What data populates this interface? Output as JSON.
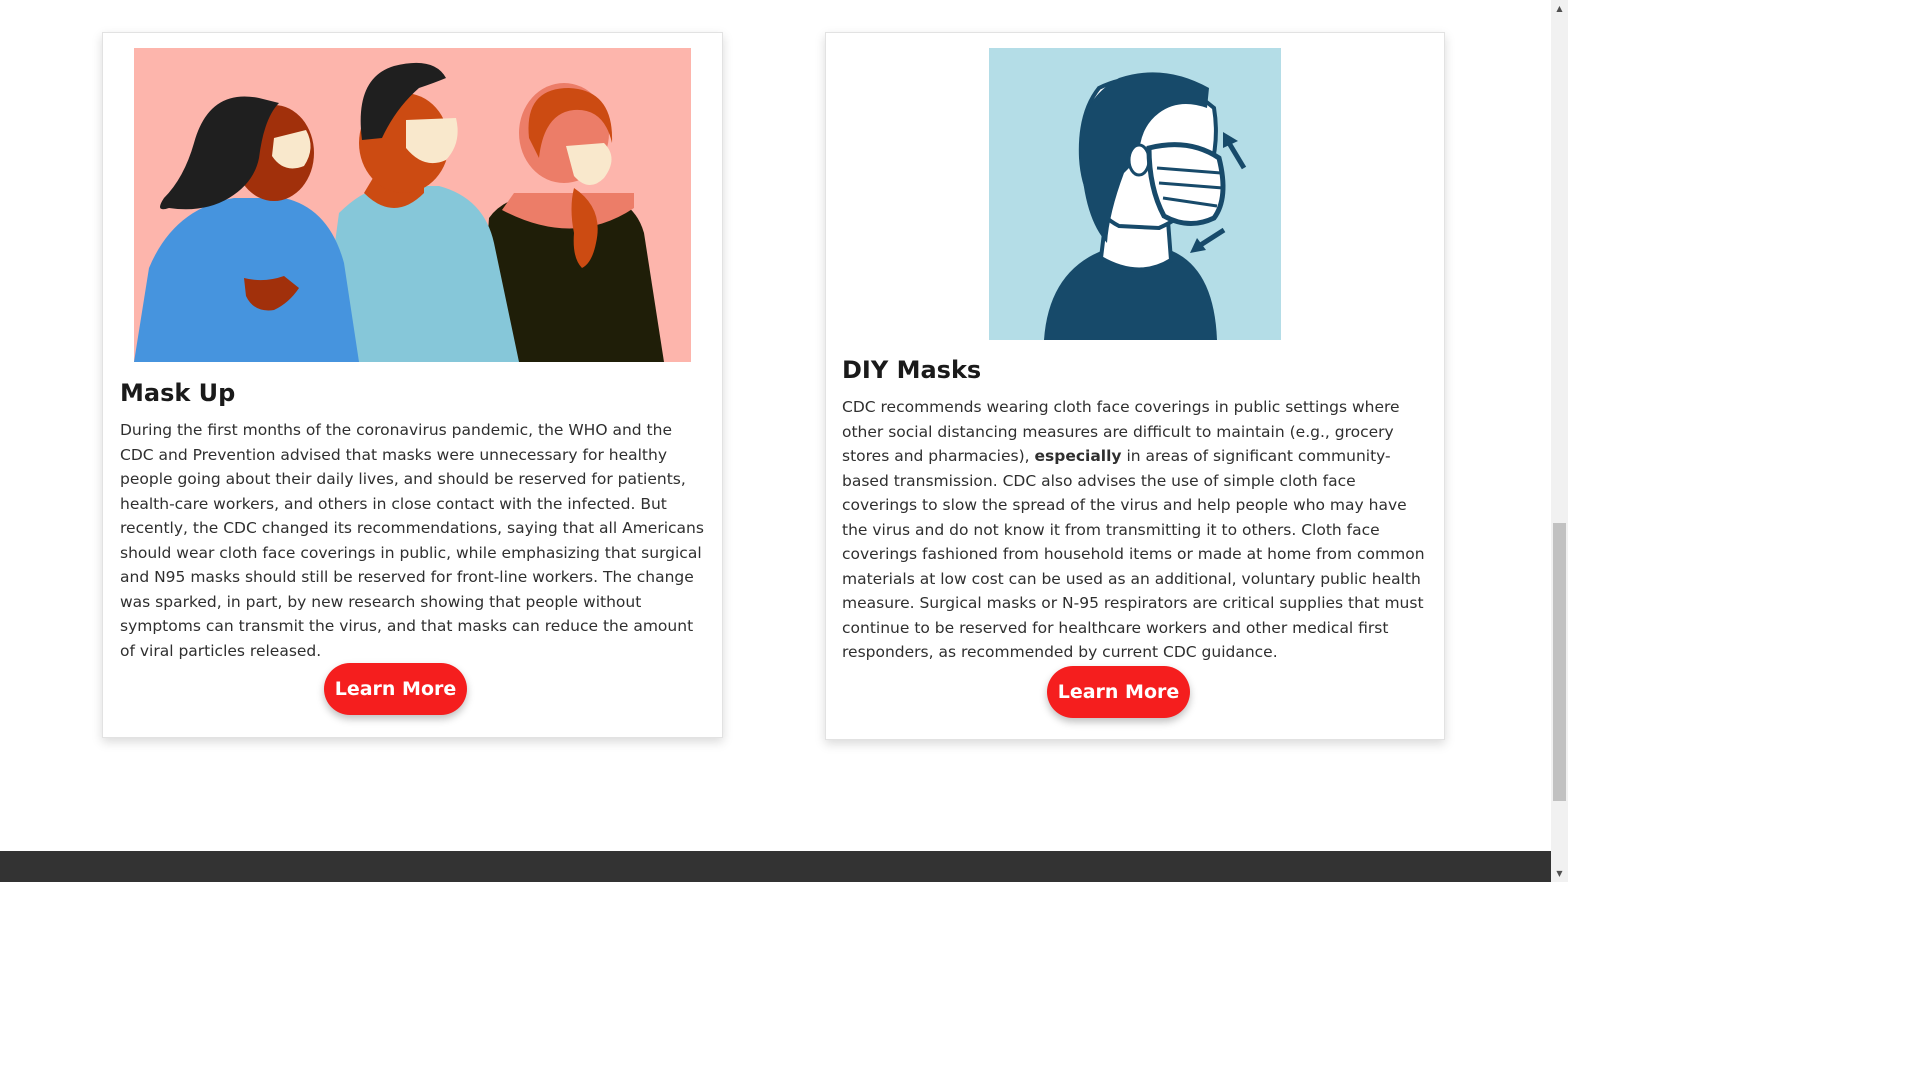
{
  "cards": [
    {
      "title": "Mask Up",
      "text": "During the first months of the coronavirus pandemic, the WHO and the CDC and Prevention advised that masks were unnecessary for healthy people going about their daily lives, and should be reserved for patients, health-care workers, and others in close contact with the infected. But recently, the CDC changed its recommendations, saying that all Americans should wear cloth face coverings in public, while emphasizing that surgical and N95 masks should still be reserved for front-line workers. The change was sparked, in part, by new research showing that people without symptoms can transmit the virus, and that masks can reduce the amount of viral particles released.",
      "button_label": "Learn More",
      "illustration": "three-people-wearing-masks",
      "illustration_bg": "#fdb5ac"
    },
    {
      "title": "DIY Masks",
      "text_part1": "CDC recommends wearing cloth face coverings in public settings where other social distancing measures are difficult to maintain (e.g., grocery stores and pharmacies), ",
      "text_emphasis": "especially",
      "text_part2": " in areas of significant community-based transmission. CDC also advises the use of simple cloth face coverings to slow the spread of the virus and help people who may have the virus and do not know it from transmitting it to others. Cloth face coverings fashioned from household items or made at home from common materials at low cost can be used as an additional, voluntary public health measure. Surgical masks or N-95 respirators are critical supplies that must continue to be reserved for healthcare workers and other medical first responders, as recommended by current CDC guidance.",
      "button_label": "Learn More",
      "illustration": "person-wearing-mask-airflow-arrows",
      "illustration_bg": "#b4dde7"
    }
  ],
  "colors": {
    "button": "#f51e1e",
    "footer": "#333333",
    "mask_dark_blue": "#174a6a"
  },
  "scrollbar": {
    "up_arrow": "▲",
    "down_arrow": "▼"
  }
}
